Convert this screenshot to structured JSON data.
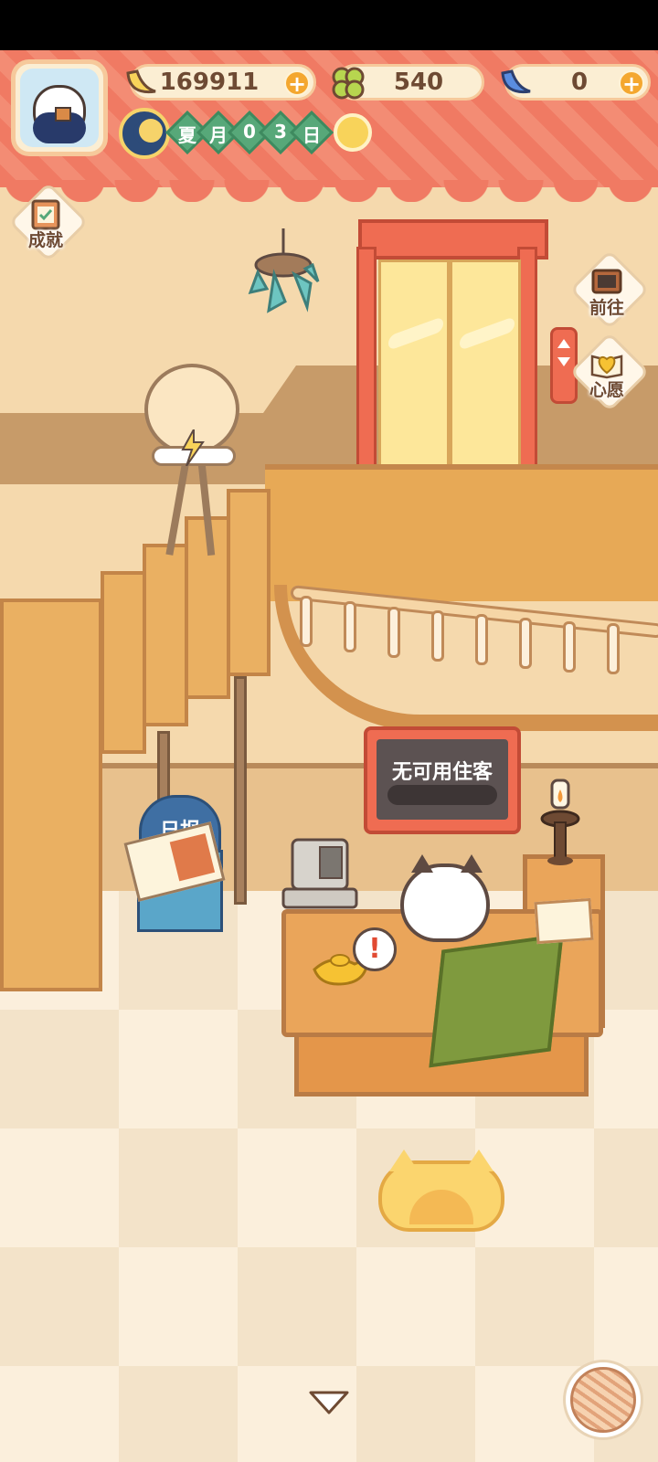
{
  "header": {
    "bananas": "169911",
    "clovers": "540",
    "blue_bananas": "0",
    "plus": "+",
    "date": {
      "season": "夏",
      "month_label": "月",
      "day_digits": [
        "0",
        "3"
      ],
      "day_label": "日"
    },
    "icons": [
      "player-avatar",
      "banana-icon",
      "clover-icon",
      "blue-banana-icon",
      "moon-icon",
      "sun-weather-icon"
    ]
  },
  "side_buttons": {
    "achievements": "成就",
    "go_to": "前往",
    "wishes": "心愿"
  },
  "scene": {
    "counter_status": "无可用住客",
    "newspaper_sign": "日报",
    "alert": "!"
  },
  "colors": {
    "banner": "#f07a63",
    "accent_plus": "#f4a72f",
    "date_chip": "#57a879",
    "elevator": "#ef6c52",
    "wood": "#eaa55a"
  }
}
